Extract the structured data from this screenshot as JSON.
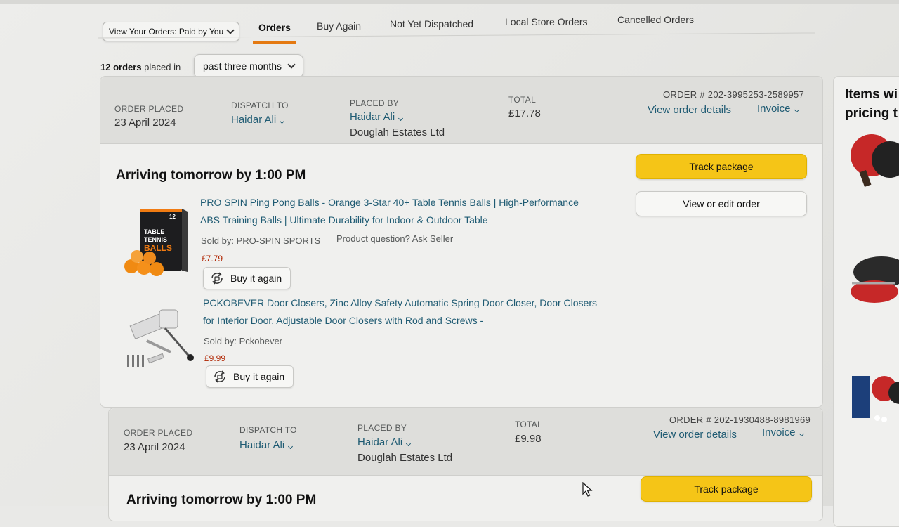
{
  "nav": {
    "filter_label": "View Your Orders: Paid by You",
    "tabs": [
      {
        "label": "Orders",
        "active": true
      },
      {
        "label": "Buy Again",
        "active": false
      },
      {
        "label": "Not Yet Dispatched",
        "active": false
      },
      {
        "label": "Local Store Orders",
        "active": false
      },
      {
        "label": "Cancelled Orders",
        "active": false
      }
    ]
  },
  "summary": {
    "count": "12 orders",
    "placed_in": "placed in",
    "period": "past three months"
  },
  "orders": [
    {
      "placed_label": "ORDER PLACED",
      "placed_date": "23 April 2024",
      "dispatch_label": "DISPATCH TO",
      "dispatch_name": "Haidar Ali",
      "placedby_label": "PLACED BY",
      "placedby_name": "Haidar Ali",
      "placedby_company": "Douglah Estates Ltd",
      "total_label": "TOTAL",
      "total": "£17.78",
      "order_number": "ORDER # 202-3995253-2589957",
      "details_link": "View order details",
      "invoice_link": "Invoice",
      "arriving": "Arriving tomorrow by 1:00 PM",
      "track_label": "Track package",
      "edit_label": "View or edit order",
      "items": [
        {
          "title_line1": "PRO SPIN Ping Pong Balls - Orange 3-Star 40+ Table Tennis Balls | High-Performance",
          "title_line2": "ABS Training Balls | Ultimate Durability for Indoor & Outdoor Table",
          "sold_by": "Sold by: PRO-SPIN SPORTS",
          "question": "Product question? Ask Seller",
          "price": "£7.79",
          "buy_again": "Buy it again",
          "box_text_1": "TABLE",
          "box_text_2": "TENNIS",
          "box_text_3": "BALLS",
          "box_count": "12"
        },
        {
          "title_line1": "PCKOBEVER Door Closers, Zinc Alloy Safety Automatic Spring Door Closer, Door Closers",
          "title_line2": "for Interior Door, Adjustable Door Closers with Rod and Screws -",
          "sold_by": "Sold by: Pckobever",
          "price": "£9.99",
          "buy_again": "Buy it again"
        }
      ]
    },
    {
      "placed_label": "ORDER PLACED",
      "placed_date": "23 April 2024",
      "dispatch_label": "DISPATCH TO",
      "dispatch_name": "Haidar Ali",
      "placedby_label": "PLACED BY",
      "placedby_name": "Haidar Ali",
      "placedby_company": "Douglah Estates Ltd",
      "total_label": "TOTAL",
      "total": "£9.98",
      "order_number": "ORDER # 202-1930488-8981969",
      "details_link": "View order details",
      "invoice_link": "Invoice",
      "arriving": "Arriving tomorrow by 1:00 PM",
      "track_label": "Track package"
    }
  ],
  "rail": {
    "title_line1": "Items wi",
    "title_line2": "pricing t"
  },
  "colors": {
    "track_button": "#f5c517",
    "link": "#1f5b73",
    "price": "#b12704",
    "active_tab_underline": "#e47911"
  },
  "icons": [
    "chevron-down-icon",
    "reorder-icon",
    "cursor-arrow-icon"
  ]
}
